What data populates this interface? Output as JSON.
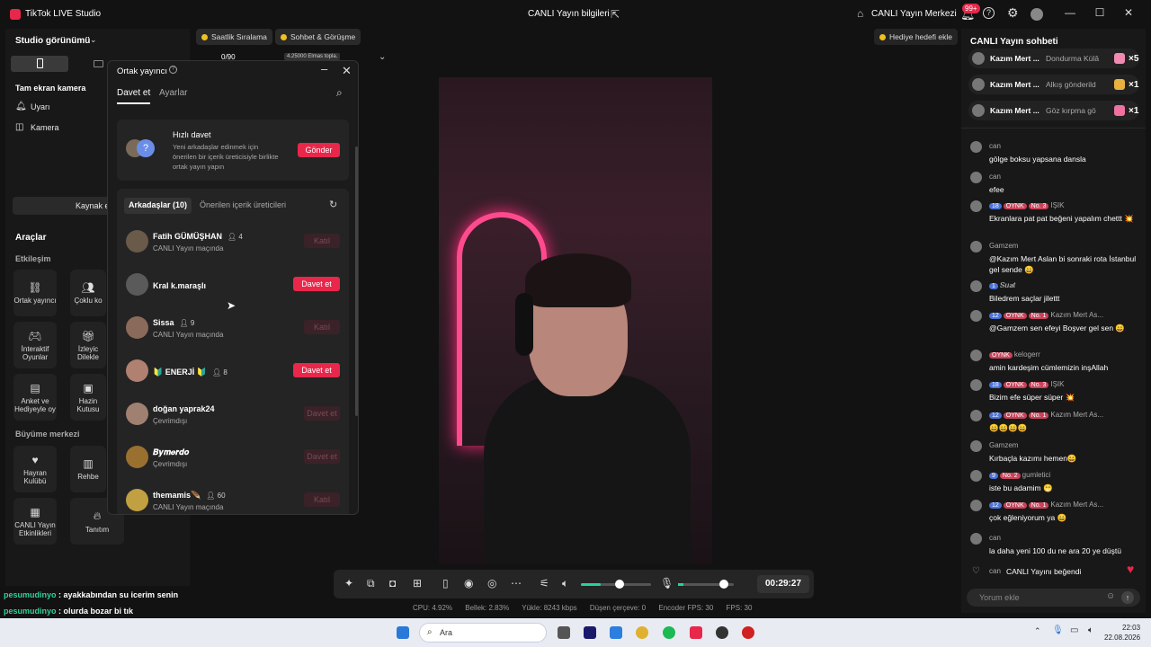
{
  "titlebar": {
    "app_title": "TikTok LIVE Studio",
    "center_title": "CANLI Yayın bilgileri",
    "live_center": "CANLI Yayın Merkezi",
    "notif_count": "99+"
  },
  "left": {
    "studio_view": "Studio görünümü",
    "fullscreen_camera": "Tam ekran kamera",
    "sources": [
      {
        "label": "Uyarı"
      },
      {
        "label": "Kamera"
      }
    ],
    "source_button": "Kaynak e",
    "tools_title": "Araçlar",
    "interaction_title": "Etkileşim",
    "growth_title": "Büyüme merkezi",
    "tools": [
      {
        "label": "Ortak yayıncı",
        "icon": "link-icon"
      },
      {
        "label": "Çoklu ko",
        "icon": "users-icon"
      },
      {
        "label": "İnteraktif Oyunlar",
        "icon": "gamepad-icon"
      },
      {
        "label": "İzleyic Dilekle",
        "icon": "gift-icon"
      },
      {
        "label": "Anket ve Hediyeyle oy",
        "icon": "poll-icon"
      },
      {
        "label": "Hazin Kutusu",
        "icon": "treasure-icon"
      }
    ],
    "growth": [
      {
        "label": "Hayran Kulübü",
        "icon": "heart-icon"
      },
      {
        "label": "Rehbe",
        "icon": "book-icon"
      },
      {
        "label": "CANLI Yayın Etkinlikleri",
        "icon": "calendar-icon"
      },
      {
        "label": "Tanıtım",
        "icon": "flame-icon"
      }
    ]
  },
  "chips": {
    "hourly": "Saatlik Sıralama",
    "chat": "Sohbet & Görüşme",
    "goal": "Hediye hedefi ekle",
    "progress": "0/90",
    "elmas": "4.25000 Elmas topla."
  },
  "modal": {
    "title": "Ortak yayıncı",
    "tab_invite": "Davet et",
    "tab_settings": "Ayarlar",
    "quick_title": "Hızlı davet",
    "quick_desc": "Yeni arkadaşlar edinmek için önerilen bir içerik üreticisiyle birlikte ortak yayın yapın",
    "quick_button": "Gönder",
    "friends_tab": "Arkadaşlar (10)",
    "suggested_tab": "Önerilen içerik üreticileri",
    "friends": [
      {
        "name": "Fatih GÜMÜŞHAN",
        "count": "4",
        "status": "CANLI Yayın maçında",
        "button": "Katıl",
        "active": false,
        "color": "#6a5a4a"
      },
      {
        "name": "Kral k.maraşlı",
        "count": "",
        "status": "",
        "button": "Davet et",
        "active": true,
        "color": "#5a5a5a"
      },
      {
        "name": "Sissa",
        "count": "9",
        "status": "CANLI Yayın maçında",
        "button": "Katıl",
        "active": false,
        "color": "#8a6a5a"
      },
      {
        "name": "🔰 ENERJİ 🔰",
        "count": "8",
        "status": "",
        "button": "Davet et",
        "active": true,
        "color": "#b08070"
      },
      {
        "name": "doğan yaprak24",
        "count": "",
        "status": "Çevrimdışı",
        "button": "Davet et",
        "active": false,
        "color": "#a08070"
      },
      {
        "name": "𝑩𝒚𝒎𝒆𝒓𝒅𝒐",
        "count": "",
        "status": "Çevrimdışı",
        "button": "Davet et",
        "active": false,
        "color": "#9a7030"
      },
      {
        "name": "themamis🪶",
        "count": "60",
        "status": "CANLI Yayın maçında",
        "button": "Katıl",
        "active": false,
        "color": "#c0a040"
      }
    ]
  },
  "controls": {
    "timer": "00:29:27"
  },
  "stats": {
    "cpu": "CPU:  4.92%",
    "mem": "Bellek:  2.83%",
    "upload": "Yükle:  8243 kbps",
    "dropped": "Düşen çerçeve:  0",
    "encoder": "Encoder FPS:  30",
    "fps": "FPS:  30"
  },
  "chat": {
    "title": "CANLI Yayın sohbeti",
    "gifts": [
      {
        "name": "Kazım Mert ...",
        "text": "Dondurma Külâ",
        "count": "×5",
        "color": "#f08ab0"
      },
      {
        "name": "Kazım Mert ...",
        "text": "Alkış gönderild",
        "count": "×1",
        "color": "#e8b040"
      },
      {
        "name": "Kazım Mert ...",
        "text": "Göz kırpma gö",
        "count": "×1",
        "color": "#f070a0"
      }
    ],
    "messages": [
      {
        "user": "can",
        "text": "gölge boksu yapsana dansla",
        "badges": []
      },
      {
        "user": "can",
        "text": "efee",
        "badges": []
      },
      {
        "user": "IŞIK",
        "text": "Ekranlara pat pat beğeni yapalım chettt 💥",
        "badges": [
          "18",
          "OYNK",
          "No. 3"
        ]
      },
      {
        "user": "Gamzem",
        "text": "@Kazım Mert Aslan bi sonraki rota İstanbul gel sende 😄",
        "badges": []
      },
      {
        "user": "𝑺𝒖𝒂𝒕",
        "text": "Biledrem saçlar jilettt",
        "badges": [
          "1"
        ]
      },
      {
        "user": "Kazım Mert As...",
        "text": "@Gamzem sen efeyi Boşver gel sen 😄",
        "badges": [
          "12",
          "OYNK",
          "No. 1"
        ]
      },
      {
        "user": "kelogerr",
        "text": "amin kardeşim cümlemizin inşAllah",
        "badges": [
          "OYNK"
        ]
      },
      {
        "user": "IŞIK",
        "text": "Bizim efe süper süper 💥",
        "badges": [
          "18",
          "OYNK",
          "No. 3"
        ]
      },
      {
        "user": "Kazım Mert As...",
        "text": "😄😄😄😄",
        "badges": [
          "12",
          "OYNK",
          "No. 1"
        ]
      },
      {
        "user": "Gamzem",
        "text": "Kırbaçla kazımı hemen😄",
        "badges": []
      },
      {
        "user": "gumletici",
        "text": "iste bu adamim 😁",
        "badges": [
          "9",
          "No. 2"
        ]
      },
      {
        "user": "Kazım Mert As...",
        "text": "çok eğleniyorum ya 😄",
        "badges": [
          "12",
          "OYNK",
          "No. 1"
        ]
      },
      {
        "user": "can",
        "text": "la daha yeni 100 du ne ara 20 ye düştü",
        "badges": []
      }
    ],
    "liked_user": "can",
    "liked_text": "CANLI Yayını beğendi",
    "comment_placeholder": "Yorum ekle"
  },
  "ticker": [
    {
      "user": "pesumudinyo",
      "text": " : ayakkabından su icerim senin"
    },
    {
      "user": "pesumudinyo",
      "text": " : olurda bozar bi tık"
    }
  ],
  "taskbar": {
    "search": "Ara",
    "time": "22:03",
    "date": "22.08.2026"
  }
}
